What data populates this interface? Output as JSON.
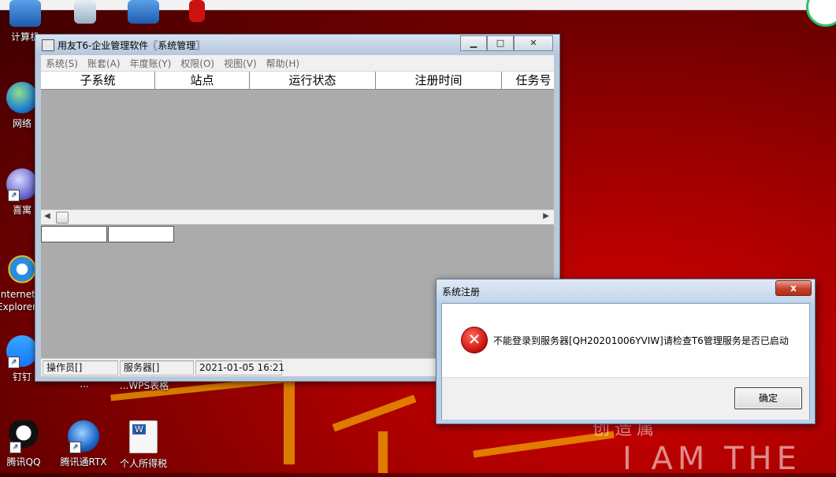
{
  "desktop": {
    "icons": [
      {
        "label": "计算机",
        "icon": "computer-icon"
      },
      {
        "label": "网络",
        "icon": "network-icon"
      },
      {
        "label": "喜寓",
        "icon": "app-icon"
      },
      {
        "label": "Internet Explorer",
        "icon": "ie-icon"
      },
      {
        "label": "钉钉",
        "icon": "dingtalk-icon"
      },
      {
        "label": "腾讯QQ",
        "icon": "qq-icon"
      },
      {
        "label": "腾讯通RTX",
        "icon": "rtx-icon"
      },
      {
        "label": "个人所得税",
        "icon": "word-document-icon"
      }
    ],
    "partial_labels": [
      "...",
      "...WPS表格"
    ]
  },
  "main_window": {
    "title": "用友T6-企业管理软件〖系统管理〗",
    "controls": {
      "minimize": "▁",
      "maximize": "□",
      "close": "✕"
    },
    "menu": [
      "系统(S)",
      "账套(A)",
      "年度账(Y)",
      "权限(O)",
      "视图(V)",
      "帮助(H)"
    ],
    "columns": [
      "子系统",
      "站点",
      "运行状态",
      "注册时间",
      "任务号"
    ],
    "status": {
      "operator": "操作员[]",
      "server": "服务器[]",
      "datetime": "2021-01-05  16:21"
    }
  },
  "dialog": {
    "title": "系统注册",
    "close_label": "x",
    "message": "不能登录到服务器[QH20201006YVIW]请检查T6管理服务是否已启动",
    "ok_label": "确定",
    "icon": "error-icon"
  },
  "wallpaper": {
    "text_chars": [
      "创",
      "造",
      "属"
    ],
    "text_latin": "I AM THE"
  },
  "colors": {
    "wallpaper_red": "#a50000",
    "accent_orange": "#f2a400",
    "error_red": "#c90d0d"
  }
}
